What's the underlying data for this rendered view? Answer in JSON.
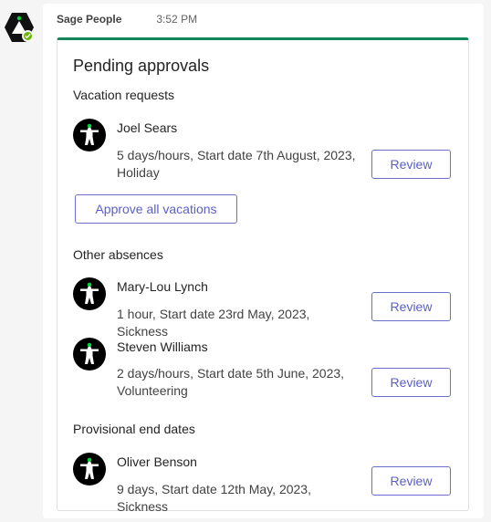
{
  "bot": {
    "avatar_icon": "sage-people-logo-icon",
    "presence_icon": "available-check-icon",
    "sender": "Sage People",
    "time": "3:52 PM"
  },
  "card": {
    "accent_color": "#128759",
    "button_color": "#5b5fc7",
    "title": "Pending approvals",
    "vacation": {
      "title": "Vacation requests",
      "items": [
        {
          "name": "Joel Sears",
          "detail": "5 days/hours, Start date 7th August, 2023, Holiday",
          "review_label": "Review",
          "avatar_icon": "person-avatar-icon"
        }
      ],
      "approve_all_label": "Approve all vacations"
    },
    "other": {
      "title": "Other absences",
      "items": [
        {
          "name": "Mary-Lou Lynch",
          "detail": "1 hour, Start date 23rd May, 2023, Sickness",
          "review_label": "Review",
          "avatar_icon": "person-avatar-icon"
        },
        {
          "name": "Steven Williams",
          "detail": "2 days/hours, Start date 5th June, 2023, Volunteering",
          "review_label": "Review",
          "avatar_icon": "person-avatar-icon"
        }
      ]
    },
    "provisional": {
      "title": "Provisional end dates",
      "items": [
        {
          "name": "Oliver Benson",
          "detail": "9 days, Start date 12th May, 2023, Sickness",
          "review_label": "Review",
          "avatar_icon": "person-avatar-icon"
        }
      ]
    }
  }
}
